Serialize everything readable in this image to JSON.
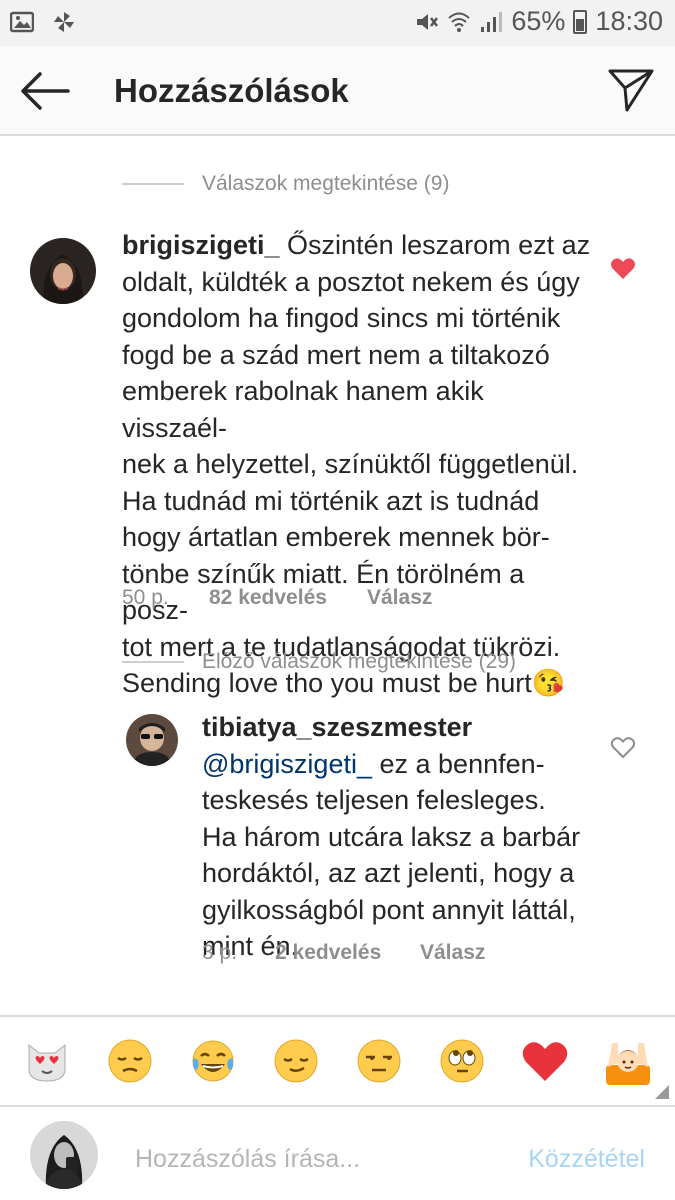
{
  "status_bar": {
    "battery": "65%",
    "time": "18:30"
  },
  "header": {
    "title": "Hozzászólások"
  },
  "thread_links": {
    "view_replies": "Válaszok megtekintése (9)",
    "previous_replies": "Előző válaszok megtekintése (29)"
  },
  "comments": [
    {
      "username": "brigiszigeti_",
      "lines": [
        "Őszintén leszarom ezt az",
        "oldalt, küldték a posztot nekem és úgy",
        "gondolom ha fingod sincs mi történik",
        "fogd be a szád mert nem a tiltakozó",
        "emberek rabolnak hanem akik visszaél-",
        "nek a helyzettel, színüktől függetlenül.",
        "Ha tudnád mi történik azt is tudnád",
        "hogy ártatlan emberek mennek bör-",
        "tönbe színűk miatt. Én törölném a posz-",
        "tot mert a te tudatlanságodat tükrözi.",
        "Sending love tho you must be hurt😘"
      ],
      "time": "50 p.",
      "likes": "82 kedvelés",
      "reply": "Válasz",
      "liked": true
    },
    {
      "username": "tibiatya_szeszmester",
      "mention": "@brigiszigeti_",
      "lines": [
        "ez a bennfen-",
        "teskesés teljesen felesleges.",
        "Ha három utcára laksz a barbár",
        "hordáktól, az azt jelenti, hogy a",
        "gyilkosságból pont annyit láttál,",
        "mint én."
      ],
      "time": "3 p.",
      "likes": "2 kedvelés",
      "reply": "Válasz",
      "liked": false
    }
  ],
  "emoji_bar": [
    "😻",
    "😔",
    "😂",
    "😌",
    "😒",
    "🙄",
    "❤️",
    "🙆"
  ],
  "composer": {
    "placeholder": "Hozzászólás írása...",
    "post_label": "Közzététel"
  },
  "colors": {
    "like_red": "#ed4956",
    "mention_blue": "#003569",
    "post_disabled_blue": "#a8d4f5"
  }
}
